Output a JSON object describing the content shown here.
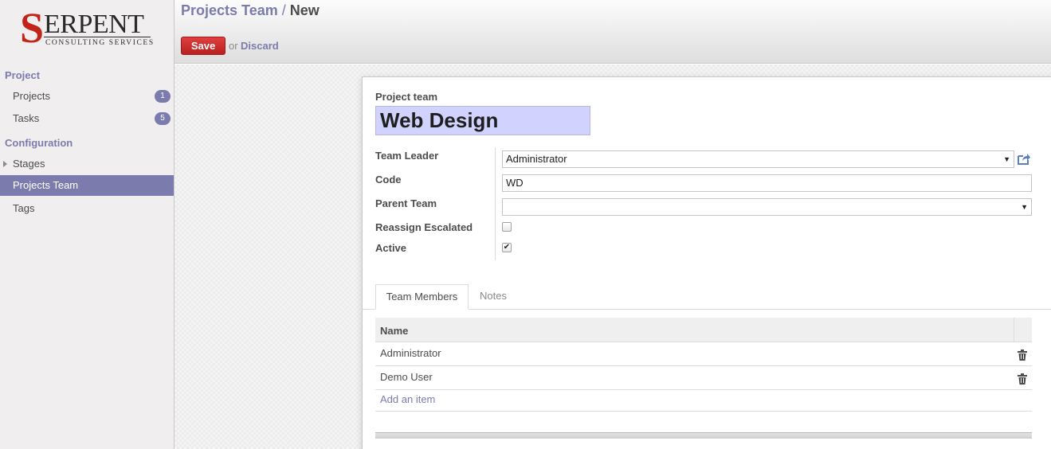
{
  "logo": {
    "letter": "S",
    "rest": "ERPENT",
    "subtitle": "CONSULTING SERVICES"
  },
  "sidebar": {
    "section1": "Project",
    "projects_label": "Projects",
    "projects_count": "1",
    "tasks_label": "Tasks",
    "tasks_count": "5",
    "section2": "Configuration",
    "stages_label": "Stages",
    "projects_team_label": "Projects Team",
    "tags_label": "Tags"
  },
  "header": {
    "breadcrumb_parent": "Projects Team",
    "breadcrumb_sep": "/",
    "breadcrumb_current": "New",
    "save_label": "Save",
    "or_text": "or",
    "discard_label": "Discard"
  },
  "form": {
    "name_label": "Project team",
    "name_value": "Web Design",
    "team_leader_label": "Team Leader",
    "team_leader_value": "Administrator",
    "code_label": "Code",
    "code_value": "WD",
    "parent_team_label": "Parent Team",
    "parent_team_value": "",
    "reassign_label": "Reassign Escalated",
    "reassign_checked": false,
    "active_label": "Active",
    "active_checked": true
  },
  "tabs": {
    "members": "Team Members",
    "notes": "Notes"
  },
  "members_table": {
    "header_name": "Name",
    "rows": [
      "Administrator",
      "Demo User"
    ],
    "add_item": "Add an item"
  },
  "colors": {
    "accent": "#7c7bad",
    "save": "#c9302c",
    "name_bg": "#d2d2ff"
  },
  "icons": {
    "external": "external-link-icon",
    "trash": "trash-icon",
    "expand": "caret-right-icon"
  }
}
